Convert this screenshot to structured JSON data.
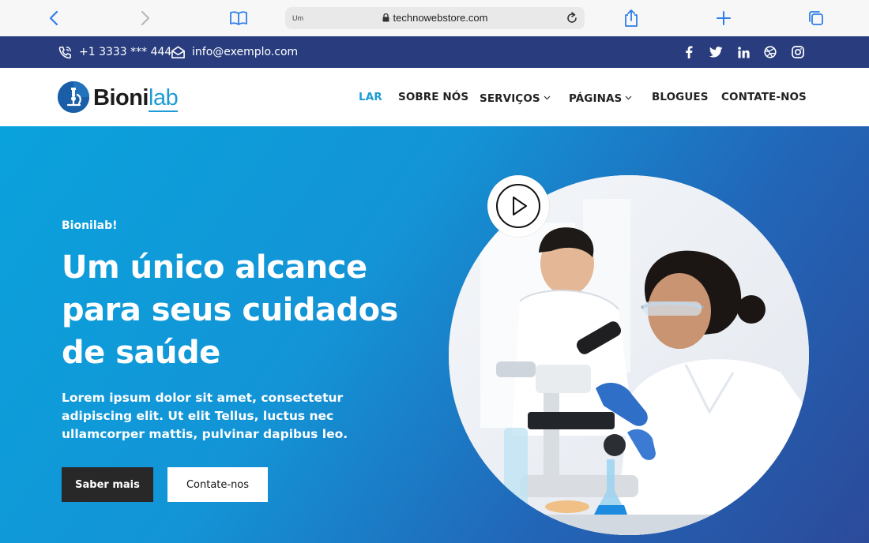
{
  "browser": {
    "tab_hint": "Um",
    "url": "technowebstore.com"
  },
  "topbar": {
    "phone": "+1 3333 *** 444",
    "email": "info@exemplo.com",
    "social_icons": [
      "facebook-icon",
      "twitter-icon",
      "linkedin-icon",
      "dribbble-icon",
      "instagram-icon"
    ]
  },
  "header": {
    "logo_part1": "Bioni",
    "logo_part2": "lab",
    "nav": {
      "home": "LAR",
      "about": "SOBRE NÓS",
      "services": "SERVIÇOS",
      "pages": "PÁGINAS",
      "blogs": "BLOGUES",
      "contact": "CONTATE-NOS"
    }
  },
  "hero": {
    "eyebrow": "Bionilab!",
    "headline": "Um único alcance para seus cuidados de saúde",
    "lead": "Lorem ipsum dolor sit amet, consectetur adipiscing elit. Ut elit Tellus, luctus nec ullamcorper mattis, pulvinar dapibus leo.",
    "primary_button": "Saber mais",
    "secondary_button": "Contate-nos"
  },
  "colors": {
    "accent": "#1d9bd6",
    "topbar": "#293d7e",
    "hero_start": "#0aa2dc",
    "hero_end": "#2c4a9a",
    "dark_button": "#282828"
  }
}
